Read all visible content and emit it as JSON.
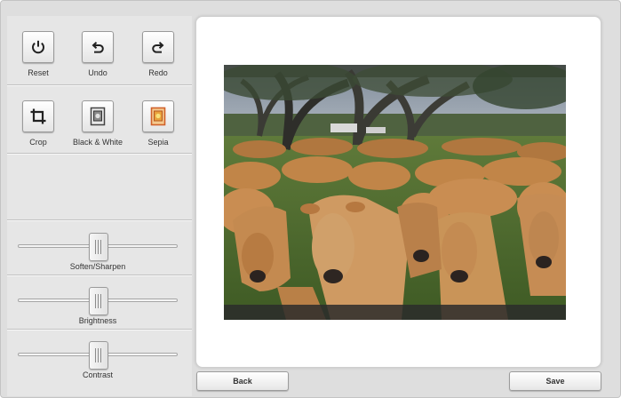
{
  "tools_top": [
    {
      "label": "Reset",
      "icon": "power-icon"
    },
    {
      "label": "Undo",
      "icon": "undo-icon"
    },
    {
      "label": "Redo",
      "icon": "redo-icon"
    }
  ],
  "tools_effects": [
    {
      "label": "Crop",
      "icon": "crop-icon"
    },
    {
      "label": "Black & White",
      "icon": "black-white-icon"
    },
    {
      "label": "Sepia",
      "icon": "sepia-icon"
    }
  ],
  "sliders": [
    {
      "label": "Soften/Sharpen",
      "value_percent": 50
    },
    {
      "label": "Brightness",
      "value_percent": 50
    },
    {
      "label": "Contrast",
      "value_percent": 50
    }
  ],
  "footer": {
    "back_label": "Back",
    "save_label": "Save"
  },
  "colors": {
    "sepia_accent": "#e06a2e",
    "sepia_fill": "#f2d48a"
  }
}
